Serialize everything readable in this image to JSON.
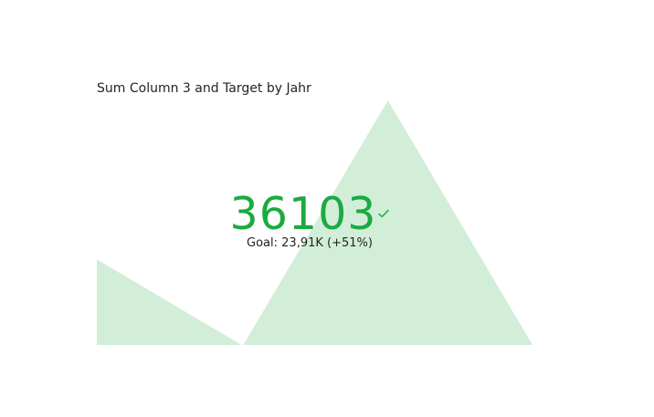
{
  "visual": {
    "title": "Sum Column 3 and Target by Jahr"
  },
  "kpi": {
    "value": "36103",
    "goal_text": "Goal: 23,91K (+51%)",
    "status": "goal-met",
    "status_icon": "check-icon",
    "value_color": "#1aab40"
  },
  "chart_data": {
    "type": "area",
    "title": "Sum Column 3 and Target by Jahr",
    "xlabel": "",
    "ylabel": "",
    "grid": false,
    "legend": "none",
    "fill_color": "#d2eed9",
    "segments": [
      [
        0.35,
        0.0
      ],
      [
        0.0,
        1.0,
        0.0
      ]
    ],
    "ylim": [
      0,
      1
    ]
  }
}
